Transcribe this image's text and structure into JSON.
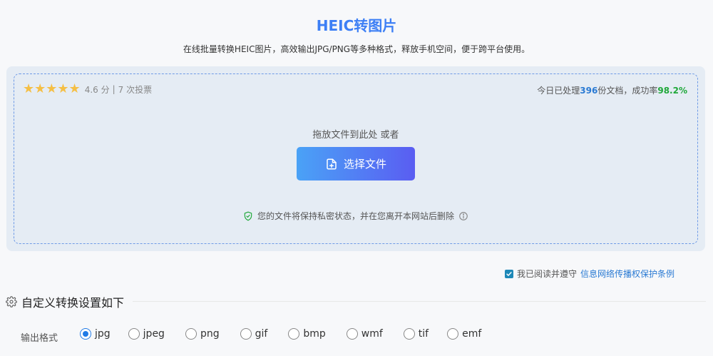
{
  "header": {
    "title": "HEIC转图片",
    "subtitle": "在线批量转换HEIC图片，高效输出JPG/PNG等多种格式，释放手机空间，便于跨平台使用。"
  },
  "upload": {
    "rating": {
      "stars": "★★★★★",
      "score": "4.6 分",
      "separator": "|",
      "votes": "7 次投票"
    },
    "stats": {
      "prefix": "今日已处理",
      "count": "396",
      "middle": "份文档，成功率",
      "rate": "98.2%"
    },
    "drop_hint": "拖放文件到此处 或者",
    "choose_button": "选择文件",
    "privacy_text": "您的文件将保持私密状态，并在您离开本网站后删除"
  },
  "agreement": {
    "prefix": "我已阅读并遵守",
    "link": "信息网络传播权保护条例",
    "checked": true
  },
  "settings": {
    "title": "自定义转换设置如下",
    "format_label": "输出格式",
    "formats": [
      "jpg",
      "jpeg",
      "png",
      "gif",
      "bmp",
      "wmf",
      "tif",
      "emf"
    ],
    "selected_format": "jpg"
  },
  "colors": {
    "title_blue": "#3d7ff5",
    "count_blue": "#2a7ad3",
    "rate_green": "#20a83a",
    "star_gold": "#f5bf45",
    "button_gradient_start": "#4aa2f6",
    "button_gradient_end": "#5a5df2"
  },
  "icons": {
    "choose_button": "file-plus-icon",
    "privacy": "shield-check-icon",
    "privacy_info": "info-icon",
    "settings": "gear-icon",
    "agreement": "checkbox-checked-icon"
  }
}
